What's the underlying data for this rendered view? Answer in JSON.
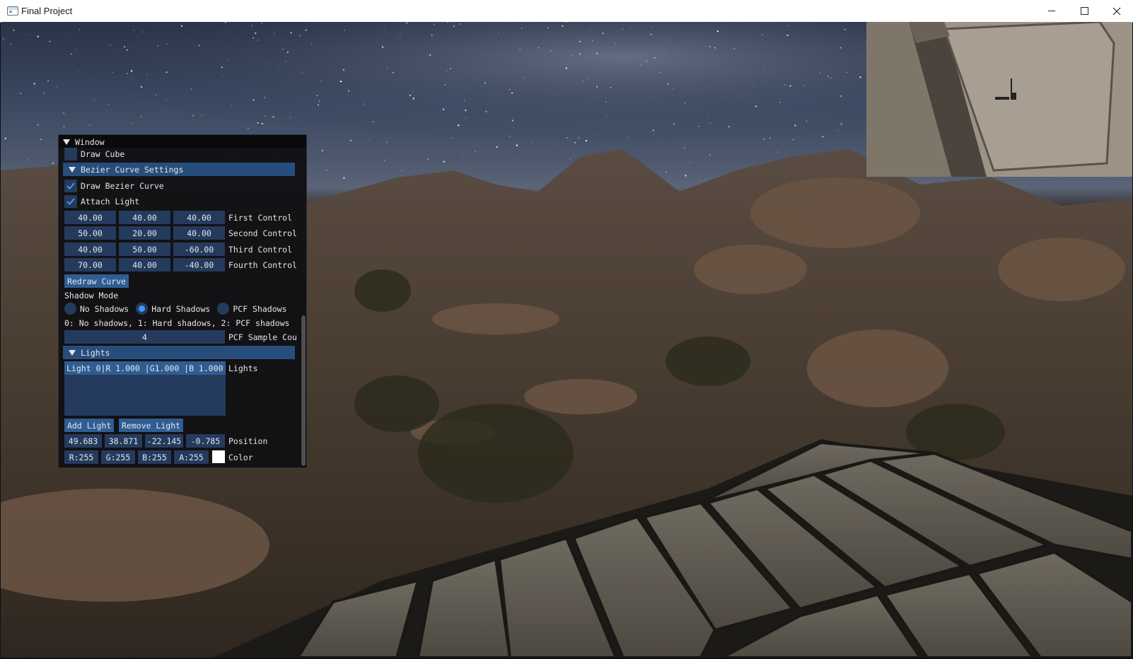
{
  "window": {
    "title": "Final Project",
    "controls": {
      "minimize": "minimize-icon",
      "maximize": "maximize-icon",
      "close": "close-icon"
    }
  },
  "panel": {
    "title": "Window",
    "draw_cube": {
      "label": "Draw Cube",
      "checked": false
    },
    "bezier": {
      "header": "Bezier Curve Settings",
      "draw_curve": {
        "label": "Draw Bezier Curve",
        "checked": true
      },
      "attach_light": {
        "label": "Attach Light",
        "checked": true
      },
      "controls": [
        {
          "label": "First Control",
          "values": [
            "40.00",
            "40.00",
            "40.00"
          ]
        },
        {
          "label": "Second Control",
          "values": [
            "50.00",
            "20.00",
            "40.00"
          ]
        },
        {
          "label": "Third Control",
          "values": [
            "40.00",
            "50.00",
            "-60.00"
          ]
        },
        {
          "label": "Fourth Control",
          "values": [
            "70.00",
            "40.00",
            "-40.00"
          ]
        }
      ],
      "redraw_button": "Redraw Curve"
    },
    "shadow": {
      "mode_label": "Shadow Mode",
      "options": [
        "No Shadows",
        "Hard Shadows",
        "PCF Shadows"
      ],
      "selected_index": 1,
      "help_text": "0: No shadows, 1: Hard shadows, 2: PCF shadows",
      "pcf_samples_value": "4",
      "pcf_samples_label": "PCF Sample Cou"
    },
    "lights": {
      "header": "Lights",
      "list_label": "Lights",
      "items": [
        "Light 0|R 1.000 |G1.000 |B 1.000"
      ],
      "add_button": "Add Light",
      "remove_button": "Remove Light",
      "position": {
        "label": "Position",
        "values": [
          "49.683",
          "38.871",
          "-22.145",
          "-0.785"
        ]
      },
      "color": {
        "label": "Color",
        "values": [
          "R:255",
          "G:255",
          "B:255",
          "A:255"
        ],
        "swatch": "#ffffff"
      }
    }
  },
  "colors": {
    "accent": "#4296fa",
    "header": "#274d7c",
    "frame": "#243b5e",
    "button": "#2f5d93"
  }
}
